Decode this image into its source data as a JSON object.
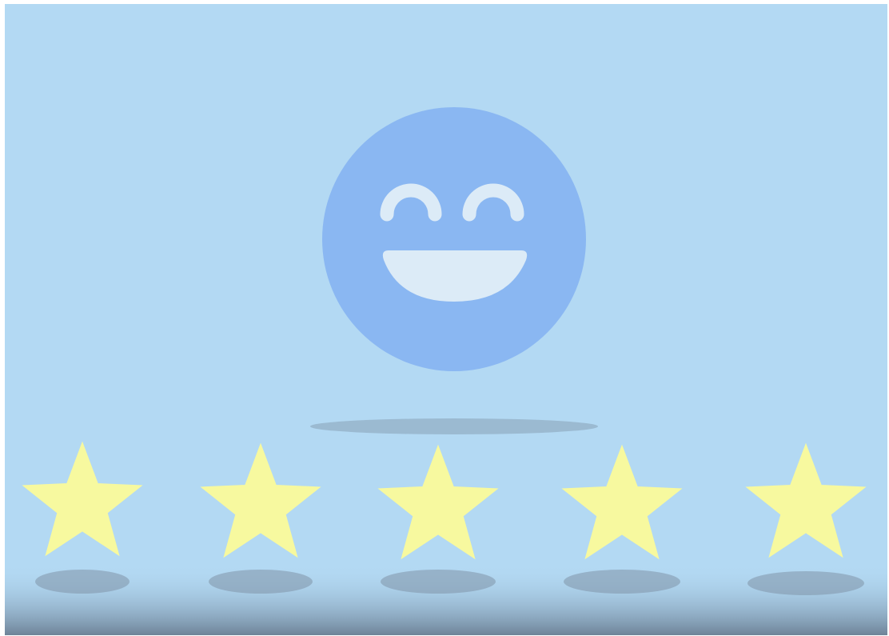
{
  "scene": {
    "subject": "smiley-face",
    "rating": 5,
    "rating_max": 5,
    "background_color": "#B3D9F3",
    "floor_gradient_bottom": "#6E8398",
    "face_color": "#8AB7F2",
    "feature_color": "#DCEBF7",
    "star_color": "#F7F99F",
    "shadow_color": "#7F94A8"
  }
}
